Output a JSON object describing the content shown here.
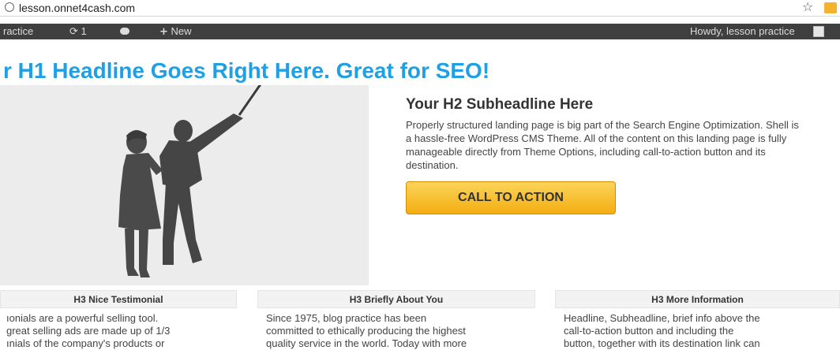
{
  "browser": {
    "url": "lesson.onnet4cash.com"
  },
  "adminbar": {
    "site": "ractice",
    "updates_count": "1",
    "new_label": "New",
    "greeting": "Howdy, lesson practice"
  },
  "hero": {
    "headline": "r H1 Headline Goes Right Here. Great for SEO!",
    "subheadline": "Your H2 Subheadline Here",
    "intro": "Properly structured landing page is big part of the Search Engine Optimization. Shell is a hassle-free WordPress CMS Theme. All of the content on this landing page is fully manageable directly from Theme Options, including call-to-action button and its destination.",
    "cta_label": "CALL TO ACTION"
  },
  "columns": [
    {
      "title": "H3 Nice Testimonial",
      "lines": [
        "ıonials are a powerful selling tool.",
        "great selling ads are made up of 1/3",
        "ınials of the company's products or"
      ]
    },
    {
      "title": "H3 Briefly About You",
      "lines": [
        "Since 1975, blog practice has been",
        "committed to ethically producing the highest",
        "quality service in the world. Today with more"
      ]
    },
    {
      "title": "H3 More Information",
      "lines": [
        "Headline, Subheadline, brief info above the",
        "call-to-action button and including the",
        "button, together with its destination link can"
      ]
    }
  ],
  "colors": {
    "headline": "#1fa0e4",
    "adminbar": "#3f3f3f",
    "cta_top": "#fcd45a",
    "cta_bottom": "#f3ad11"
  }
}
